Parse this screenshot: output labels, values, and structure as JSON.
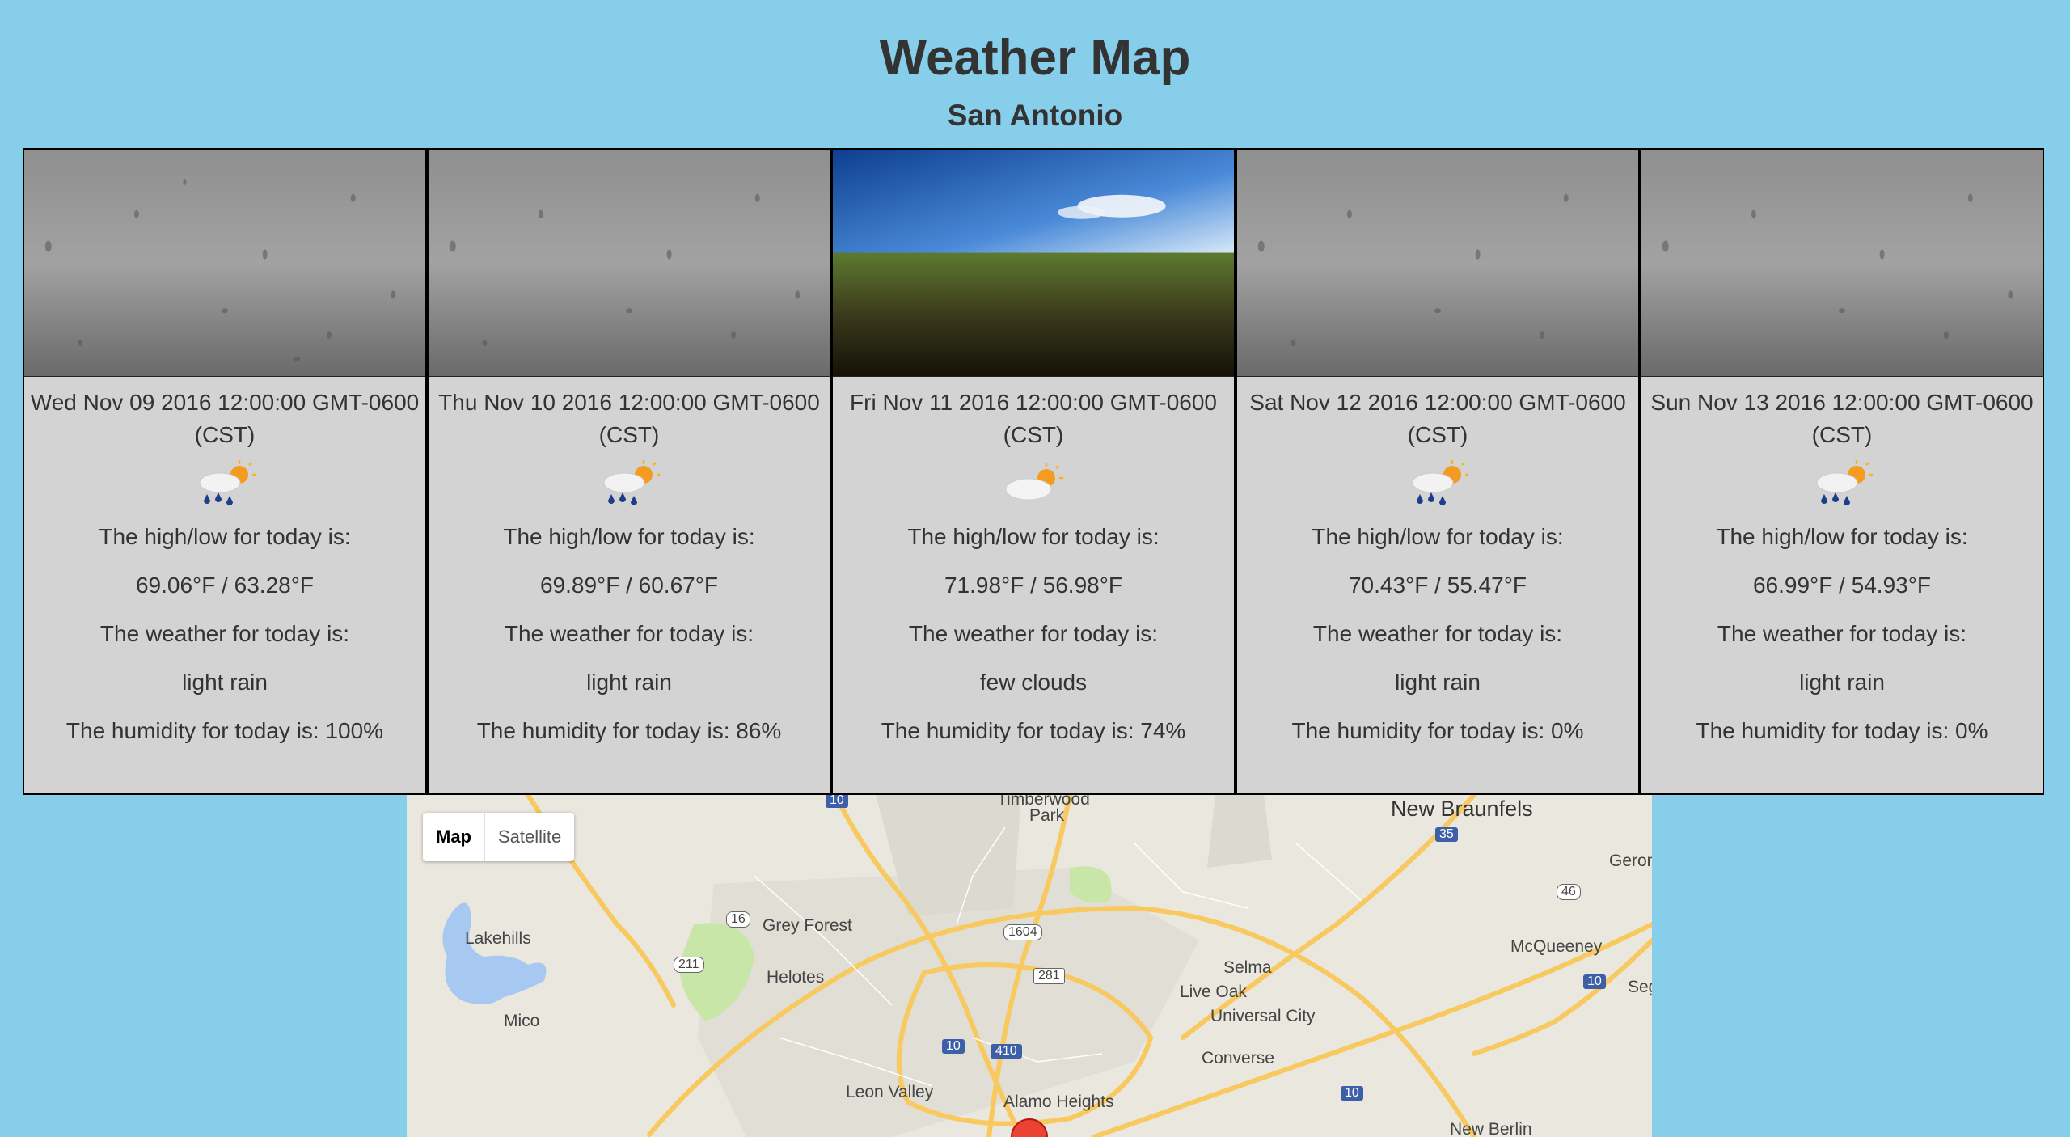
{
  "header": {
    "title": "Weather Map",
    "city": "San Antonio"
  },
  "days": [
    {
      "date": "Wed Nov 09 2016 12:00:00 GMT-0600 (CST)",
      "photo": "rain-on-glass",
      "icon": "rain-sun-icon",
      "highlow_label": "The high/low for today is:",
      "highlow": "69.06°F / 63.28°F",
      "weather_label": "The weather for today is:",
      "weather": "light rain",
      "humidity": "The humidity for today is: 100%"
    },
    {
      "date": "Thu Nov 10 2016 12:00:00 GMT-0600 (CST)",
      "photo": "rain-on-glass",
      "icon": "rain-sun-icon",
      "highlow_label": "The high/low for today is:",
      "highlow": "69.89°F / 60.67°F",
      "weather_label": "The weather for today is:",
      "weather": "light rain",
      "humidity": "The humidity for today is: 86%"
    },
    {
      "date": "Fri Nov 11 2016 12:00:00 GMT-0600 (CST)",
      "photo": "grass-field-blue-sky",
      "icon": "cloud-sun-icon",
      "highlow_label": "The high/low for today is:",
      "highlow": "71.98°F / 56.98°F",
      "weather_label": "The weather for today is:",
      "weather": "few clouds",
      "humidity": "The humidity for today is: 74%"
    },
    {
      "date": "Sat Nov 12 2016 12:00:00 GMT-0600 (CST)",
      "photo": "rain-on-glass",
      "icon": "rain-sun-icon",
      "highlow_label": "The high/low for today is:",
      "highlow": "70.43°F / 55.47°F",
      "weather_label": "The weather for today is:",
      "weather": "light rain",
      "humidity": "The humidity for today is: 0%"
    },
    {
      "date": "Sun Nov 13 2016 12:00:00 GMT-0600 (CST)",
      "photo": "rain-on-glass",
      "icon": "rain-sun-icon",
      "highlow_label": "The high/low for today is:",
      "highlow": "66.99°F / 54.93°F",
      "weather_label": "The weather for today is:",
      "weather": "light rain",
      "humidity": "The humidity for today is: 0%"
    }
  ],
  "map": {
    "type_buttons": {
      "map": "Map",
      "satellite": "Satellite",
      "selected": "Map"
    },
    "places": {
      "timberwood": "Timberwood",
      "park": "Park",
      "new_braunfels": "New Braunfels",
      "geron": "Geron",
      "grey_forest": "Grey Forest",
      "lakehills": "Lakehills",
      "helotes": "Helotes",
      "selma": "Selma",
      "live_oak": "Live Oak",
      "mcqueeney": "McQueeney",
      "universal_city": "Universal City",
      "seg": "Seg",
      "mico": "Mico",
      "converse": "Converse",
      "leon_valley": "Leon Valley",
      "alamo_heights": "Alamo Heights",
      "new_berlin": "New Berlin"
    },
    "shields": {
      "i10_north": "10",
      "i35": "35",
      "r46": "46",
      "r16": "16",
      "r1604": "1604",
      "r211": "211",
      "us281": "281",
      "i10_east": "10",
      "i10_center": "10",
      "i410": "410",
      "i10_south": "10"
    },
    "colors": {
      "water": "#a7c8f0",
      "park": "#c7e6a8",
      "road": "#f7c95f",
      "bg": "#eae7df"
    }
  }
}
